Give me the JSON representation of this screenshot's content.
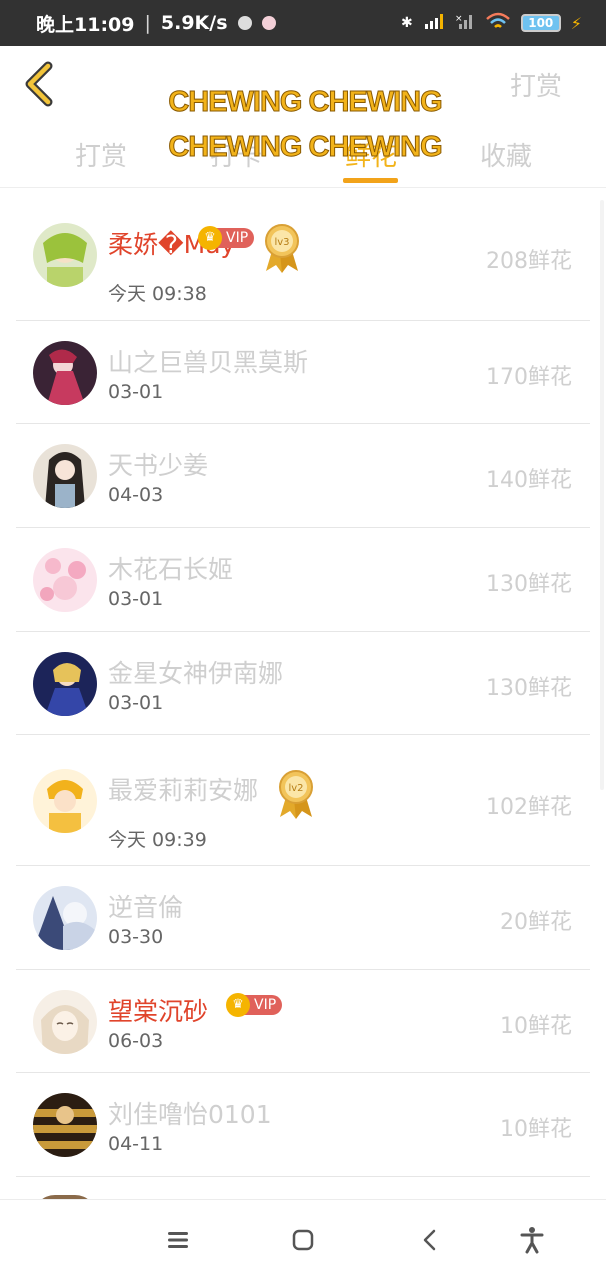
{
  "status_bar": {
    "time": "晚上11:09",
    "speed": "5.9K/s",
    "battery": "100"
  },
  "header": {
    "reward_label": "打赏",
    "overlay_line1": "CHEWING CHEWING",
    "overlay_line2": "CHEWING CHEWING"
  },
  "tabs": [
    {
      "label": "打赏"
    },
    {
      "label": "打卡"
    },
    {
      "label": "鲜花"
    },
    {
      "label": "收藏"
    }
  ],
  "active_tab": "鲜花",
  "colors": {
    "accent": "#f2a31a",
    "vip_name": "#e0442b",
    "vip_tag": "#e0615a"
  },
  "list": [
    {
      "name": "柔娇�May",
      "date": "今天 09:38",
      "amount": "208鲜花",
      "vip": "VIP",
      "medal": "lv3"
    },
    {
      "name": "山之巨兽贝黑莫斯",
      "date": "03-01",
      "amount": "170鲜花"
    },
    {
      "name": "天书少姜",
      "date": "04-03",
      "amount": "140鲜花"
    },
    {
      "name": "木花石长姬",
      "date": "03-01",
      "amount": "130鲜花"
    },
    {
      "name": "金星女神伊南娜",
      "date": "03-01",
      "amount": "130鲜花"
    },
    {
      "name": "最爱莉莉安娜",
      "date": "今天 09:39",
      "amount": "102鲜花",
      "medal": "lv2"
    },
    {
      "name": "逆音倫",
      "date": "03-30",
      "amount": "20鲜花"
    },
    {
      "name": "望棠沉砂",
      "date": "06-03",
      "amount": "10鲜花",
      "vip": "VIP"
    },
    {
      "name": "刘佳噜怡0101",
      "date": "04-11",
      "amount": "10鲜花"
    }
  ],
  "icons": {
    "back": "chevron-left-icon",
    "menu": "menu-icon",
    "home": "home-icon",
    "nav_back": "nav-back-icon",
    "accessibility": "accessibility-icon"
  }
}
